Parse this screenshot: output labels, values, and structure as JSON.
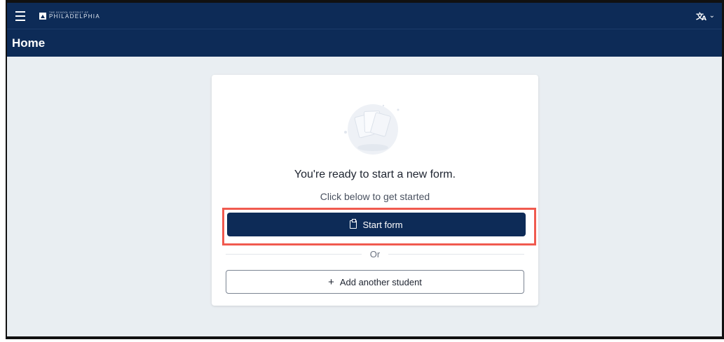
{
  "header": {
    "logo_small": "THE SCHOOL DISTRICT OF",
    "logo_big": "PHILADELPHIA",
    "language_icon": "translate-icon"
  },
  "page": {
    "title": "Home"
  },
  "card": {
    "heading": "You're ready to start a new form.",
    "subheading": "Click below to get started",
    "start_button": "Start form",
    "divider_text": "Or",
    "add_button": "Add another student"
  },
  "colors": {
    "navy": "#0d2b57",
    "highlight": "#f05a4f",
    "background": "#e9eef2"
  }
}
